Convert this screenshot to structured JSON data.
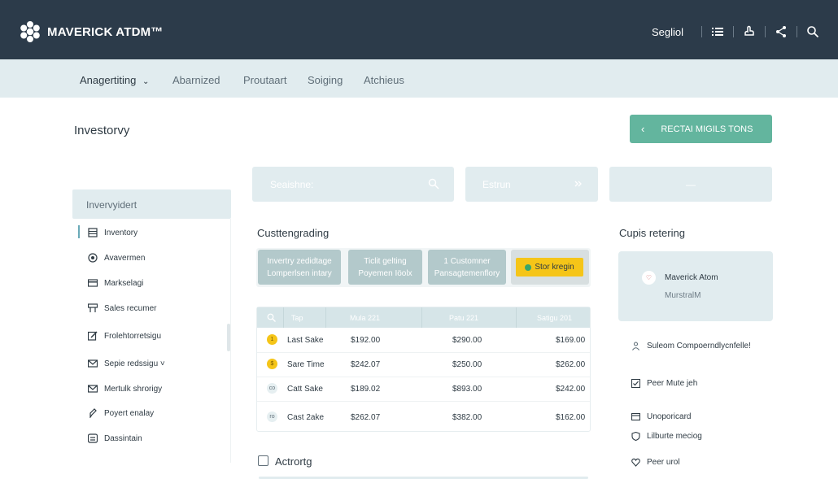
{
  "header": {
    "logo_text": "MAVERICK ATDM™",
    "user_label": "Segliol"
  },
  "nav": [
    {
      "label": "Anagertiting",
      "active": true
    },
    {
      "label": "Abarnized"
    },
    {
      "label": "Proutaart"
    },
    {
      "label": "Soiging"
    },
    {
      "label": "Atchieus"
    }
  ],
  "page": {
    "title": "Investorvy",
    "cta_label": "RECTAI MIGILS TONS"
  },
  "sidebar": {
    "header": "Invervyidert",
    "items": [
      {
        "label": "Inventory",
        "icon": "grid-icon"
      },
      {
        "label": "Avavermen",
        "icon": "target-icon"
      },
      {
        "label": "Markselagi",
        "icon": "card-icon"
      },
      {
        "label": "Sales recumer",
        "icon": "register-icon"
      },
      {
        "label": "Frolehtorretsigu",
        "icon": "edit-icon"
      },
      {
        "label": "Sepie redssigu ˅",
        "icon": "mail-icon"
      },
      {
        "label": "Mertulk shrorigy",
        "icon": "mail-icon"
      },
      {
        "label": "Poyert enalay",
        "icon": "pen-icon"
      },
      {
        "label": "Dassintain",
        "icon": "storage-icon"
      }
    ]
  },
  "filters": {
    "search_placeholder": "Seaishne:",
    "filter2_label": "Estrun",
    "filter3_label": "—"
  },
  "customer_section": {
    "title": "Custtengrading",
    "chips": [
      "Invertry zedidtage Lomperlsen intary",
      "Ticlit gelting Poyemen Iöolx",
      "1 Customner Pansagtemenflory",
      "Stor kregin"
    ]
  },
  "table": {
    "columns": [
      "Tap",
      "Mula 221",
      "Patu 221",
      "Satigu 201"
    ],
    "rows": [
      {
        "icon": "1",
        "icon_color": "#f5c518",
        "name": "Last Sake",
        "c1": "$192.00",
        "c2": "$290.00",
        "c3": "$169.00"
      },
      {
        "icon": "$",
        "icon_color": "#f5c518",
        "name": "Sare Time",
        "c1": "$242.07",
        "c2": "$250.00",
        "c3": "$262.00"
      },
      {
        "icon": "co",
        "icon_color": "#e6eff1",
        "name": "Catt Sake",
        "c1": "$189.02",
        "c2": "$893.00",
        "c3": "$242.00"
      },
      {
        "icon": "ro",
        "icon_color": "#e6eff1",
        "name": "Cast 2ake",
        "c1": "$262.07",
        "c2": "$382.00",
        "c3": "$162.00"
      }
    ]
  },
  "activity_label": "Actrortg",
  "right_panel": {
    "title": "Cupis retering",
    "card": {
      "name": "Maverick Atom",
      "sub": "MurstralM"
    },
    "items": [
      {
        "label": "Suleom Compoerndlycnfelle!",
        "icon": "user-icon"
      },
      {
        "label": "Peer Mute jeh",
        "icon": "check-icon"
      },
      {
        "label": "Unoporicard",
        "icon": "card-icon"
      },
      {
        "label": "Lilburte meciog",
        "icon": "shield-icon"
      },
      {
        "label": "Peer urol",
        "icon": "heart-icon"
      }
    ]
  },
  "colors": {
    "header_bg": "#2c3b4a",
    "nav_bg": "#e1ecef",
    "accent": "#63b59e",
    "highlight": "#f5c518"
  }
}
